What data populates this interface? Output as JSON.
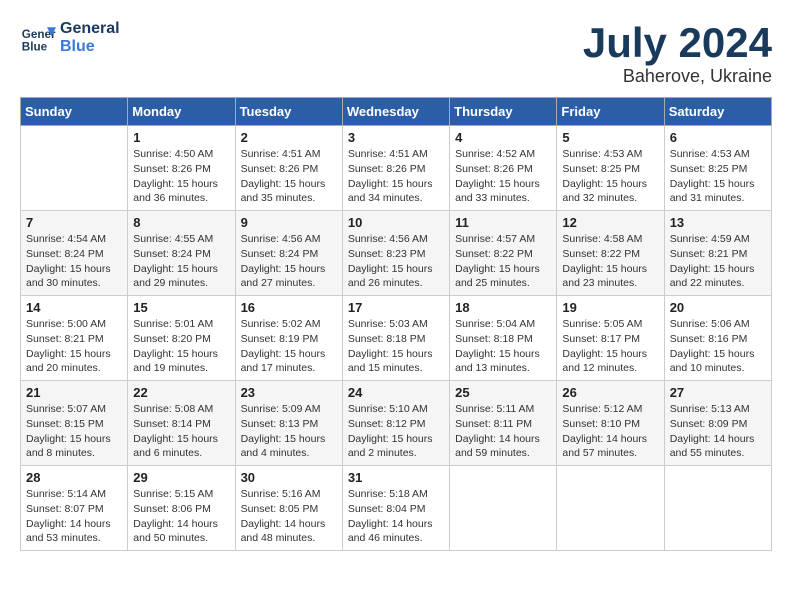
{
  "header": {
    "logo_line1": "General",
    "logo_line2": "Blue",
    "month_year": "July 2024",
    "location": "Baherove, Ukraine"
  },
  "days_of_week": [
    "Sunday",
    "Monday",
    "Tuesday",
    "Wednesday",
    "Thursday",
    "Friday",
    "Saturday"
  ],
  "weeks": [
    [
      {
        "day": "",
        "info": ""
      },
      {
        "day": "1",
        "info": "Sunrise: 4:50 AM\nSunset: 8:26 PM\nDaylight: 15 hours\nand 36 minutes."
      },
      {
        "day": "2",
        "info": "Sunrise: 4:51 AM\nSunset: 8:26 PM\nDaylight: 15 hours\nand 35 minutes."
      },
      {
        "day": "3",
        "info": "Sunrise: 4:51 AM\nSunset: 8:26 PM\nDaylight: 15 hours\nand 34 minutes."
      },
      {
        "day": "4",
        "info": "Sunrise: 4:52 AM\nSunset: 8:26 PM\nDaylight: 15 hours\nand 33 minutes."
      },
      {
        "day": "5",
        "info": "Sunrise: 4:53 AM\nSunset: 8:25 PM\nDaylight: 15 hours\nand 32 minutes."
      },
      {
        "day": "6",
        "info": "Sunrise: 4:53 AM\nSunset: 8:25 PM\nDaylight: 15 hours\nand 31 minutes."
      }
    ],
    [
      {
        "day": "7",
        "info": "Sunrise: 4:54 AM\nSunset: 8:24 PM\nDaylight: 15 hours\nand 30 minutes."
      },
      {
        "day": "8",
        "info": "Sunrise: 4:55 AM\nSunset: 8:24 PM\nDaylight: 15 hours\nand 29 minutes."
      },
      {
        "day": "9",
        "info": "Sunrise: 4:56 AM\nSunset: 8:24 PM\nDaylight: 15 hours\nand 27 minutes."
      },
      {
        "day": "10",
        "info": "Sunrise: 4:56 AM\nSunset: 8:23 PM\nDaylight: 15 hours\nand 26 minutes."
      },
      {
        "day": "11",
        "info": "Sunrise: 4:57 AM\nSunset: 8:22 PM\nDaylight: 15 hours\nand 25 minutes."
      },
      {
        "day": "12",
        "info": "Sunrise: 4:58 AM\nSunset: 8:22 PM\nDaylight: 15 hours\nand 23 minutes."
      },
      {
        "day": "13",
        "info": "Sunrise: 4:59 AM\nSunset: 8:21 PM\nDaylight: 15 hours\nand 22 minutes."
      }
    ],
    [
      {
        "day": "14",
        "info": "Sunrise: 5:00 AM\nSunset: 8:21 PM\nDaylight: 15 hours\nand 20 minutes."
      },
      {
        "day": "15",
        "info": "Sunrise: 5:01 AM\nSunset: 8:20 PM\nDaylight: 15 hours\nand 19 minutes."
      },
      {
        "day": "16",
        "info": "Sunrise: 5:02 AM\nSunset: 8:19 PM\nDaylight: 15 hours\nand 17 minutes."
      },
      {
        "day": "17",
        "info": "Sunrise: 5:03 AM\nSunset: 8:18 PM\nDaylight: 15 hours\nand 15 minutes."
      },
      {
        "day": "18",
        "info": "Sunrise: 5:04 AM\nSunset: 8:18 PM\nDaylight: 15 hours\nand 13 minutes."
      },
      {
        "day": "19",
        "info": "Sunrise: 5:05 AM\nSunset: 8:17 PM\nDaylight: 15 hours\nand 12 minutes."
      },
      {
        "day": "20",
        "info": "Sunrise: 5:06 AM\nSunset: 8:16 PM\nDaylight: 15 hours\nand 10 minutes."
      }
    ],
    [
      {
        "day": "21",
        "info": "Sunrise: 5:07 AM\nSunset: 8:15 PM\nDaylight: 15 hours\nand 8 minutes."
      },
      {
        "day": "22",
        "info": "Sunrise: 5:08 AM\nSunset: 8:14 PM\nDaylight: 15 hours\nand 6 minutes."
      },
      {
        "day": "23",
        "info": "Sunrise: 5:09 AM\nSunset: 8:13 PM\nDaylight: 15 hours\nand 4 minutes."
      },
      {
        "day": "24",
        "info": "Sunrise: 5:10 AM\nSunset: 8:12 PM\nDaylight: 15 hours\nand 2 minutes."
      },
      {
        "day": "25",
        "info": "Sunrise: 5:11 AM\nSunset: 8:11 PM\nDaylight: 14 hours\nand 59 minutes."
      },
      {
        "day": "26",
        "info": "Sunrise: 5:12 AM\nSunset: 8:10 PM\nDaylight: 14 hours\nand 57 minutes."
      },
      {
        "day": "27",
        "info": "Sunrise: 5:13 AM\nSunset: 8:09 PM\nDaylight: 14 hours\nand 55 minutes."
      }
    ],
    [
      {
        "day": "28",
        "info": "Sunrise: 5:14 AM\nSunset: 8:07 PM\nDaylight: 14 hours\nand 53 minutes."
      },
      {
        "day": "29",
        "info": "Sunrise: 5:15 AM\nSunset: 8:06 PM\nDaylight: 14 hours\nand 50 minutes."
      },
      {
        "day": "30",
        "info": "Sunrise: 5:16 AM\nSunset: 8:05 PM\nDaylight: 14 hours\nand 48 minutes."
      },
      {
        "day": "31",
        "info": "Sunrise: 5:18 AM\nSunset: 8:04 PM\nDaylight: 14 hours\nand 46 minutes."
      },
      {
        "day": "",
        "info": ""
      },
      {
        "day": "",
        "info": ""
      },
      {
        "day": "",
        "info": ""
      }
    ]
  ]
}
